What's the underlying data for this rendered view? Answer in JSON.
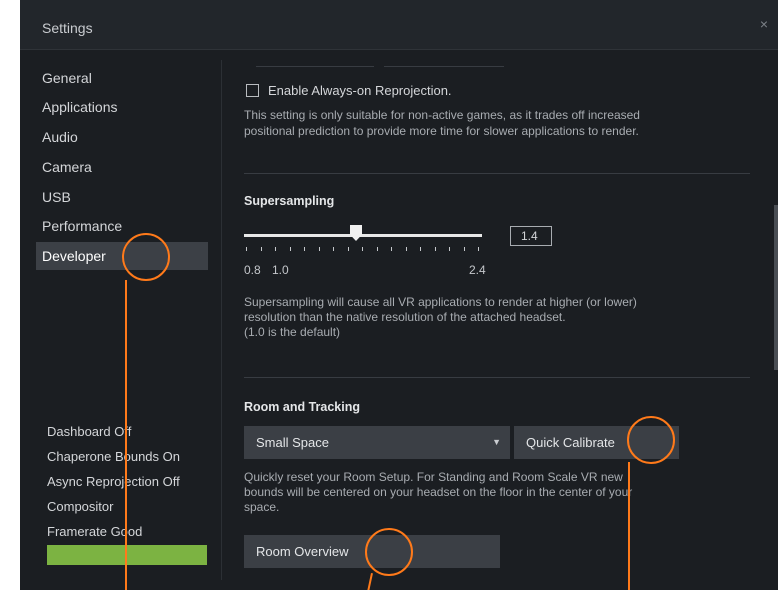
{
  "window": {
    "title": "Settings",
    "close_glyph": "×"
  },
  "sidebar": {
    "items": [
      {
        "label": "General"
      },
      {
        "label": "Applications"
      },
      {
        "label": "Audio"
      },
      {
        "label": "Camera"
      },
      {
        "label": "USB"
      },
      {
        "label": "Performance"
      },
      {
        "label": "Developer",
        "active": true
      }
    ],
    "status": [
      {
        "label": "Dashboard Off"
      },
      {
        "label": "Chaperone Bounds On"
      },
      {
        "label": "Async Reprojection Off"
      },
      {
        "label": "Compositor"
      },
      {
        "label": "Framerate Good"
      }
    ],
    "status_bar_color": "#7cb342"
  },
  "reprojection": {
    "checkbox_label": "Enable Always-on Reprojection.",
    "checked": false,
    "desc_line1": "This setting is only suitable for non-active games, as it trades off increased",
    "desc_line2": "positional prediction to provide more time for slower applications to render."
  },
  "supersampling": {
    "heading": "Supersampling",
    "value": "1.4",
    "min_label": "0.8",
    "mid_label": "1.0",
    "max_label": "2.4",
    "desc_line1": "Supersampling will cause all VR applications to render at higher (or lower)",
    "desc_line2": "resolution than the native resolution of the attached headset.",
    "desc_line3": "(1.0 is the default)"
  },
  "room": {
    "heading": "Room and Tracking",
    "dropdown_value": "Small Space",
    "quick_calibrate": "Quick Calibrate",
    "desc_line1": "Quickly reset your Room Setup. For Standing and Room Scale VR new",
    "desc_line2": "bounds will be centered on your headset on the floor in the center of your",
    "desc_line3": "space.",
    "room_overview": "Room Overview"
  },
  "annotation_color": "#ff7a1a"
}
